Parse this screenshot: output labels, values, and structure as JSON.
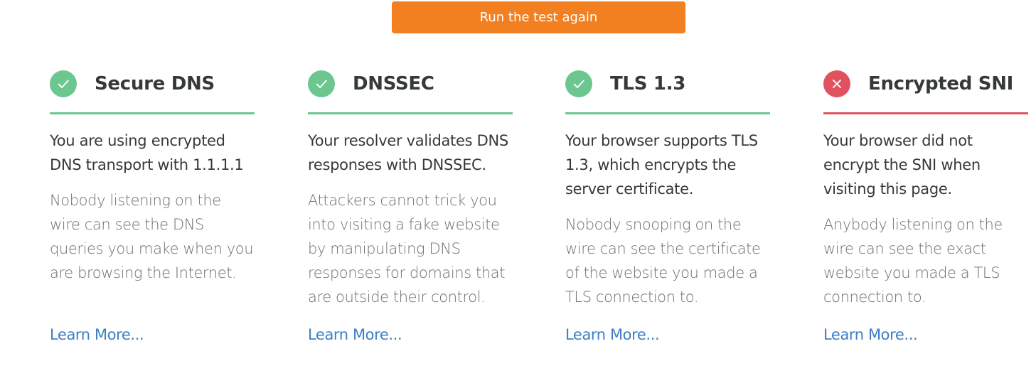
{
  "run_button": {
    "label": "Run the test again"
  },
  "colors": {
    "accent": "#f38020",
    "pass": "#6bc78f",
    "fail": "#e05260",
    "link": "#3b7fc4"
  },
  "cards": [
    {
      "status": "pass",
      "icon": "check-icon",
      "title": "Secure DNS",
      "lead": "You are using encrypted DNS transport with 1.1.1.1",
      "detail": "Nobody listening on the wire can see the DNS queries you make when you are browsing the Internet.",
      "link": "Learn More..."
    },
    {
      "status": "pass",
      "icon": "check-icon",
      "title": "DNSSEC",
      "lead": "Your resolver validates DNS responses with DNSSEC.",
      "detail": "Attackers cannot trick you into visiting a fake website by manipulating DNS responses for domains that are outside their control.",
      "link": "Learn More..."
    },
    {
      "status": "pass",
      "icon": "check-icon",
      "title": "TLS 1.3",
      "lead": "Your browser supports TLS 1.3, which encrypts the server certificate.",
      "detail": "Nobody snooping on the wire can see the certificate of the website you made a TLS connection to.",
      "link": "Learn More..."
    },
    {
      "status": "fail",
      "icon": "x-icon",
      "title": "Encrypted SNI",
      "lead": "Your browser did not encrypt the SNI when visiting this page.",
      "detail": "Anybody listening on the wire can see the exact website you made a TLS connection to.",
      "link": "Learn More..."
    }
  ]
}
